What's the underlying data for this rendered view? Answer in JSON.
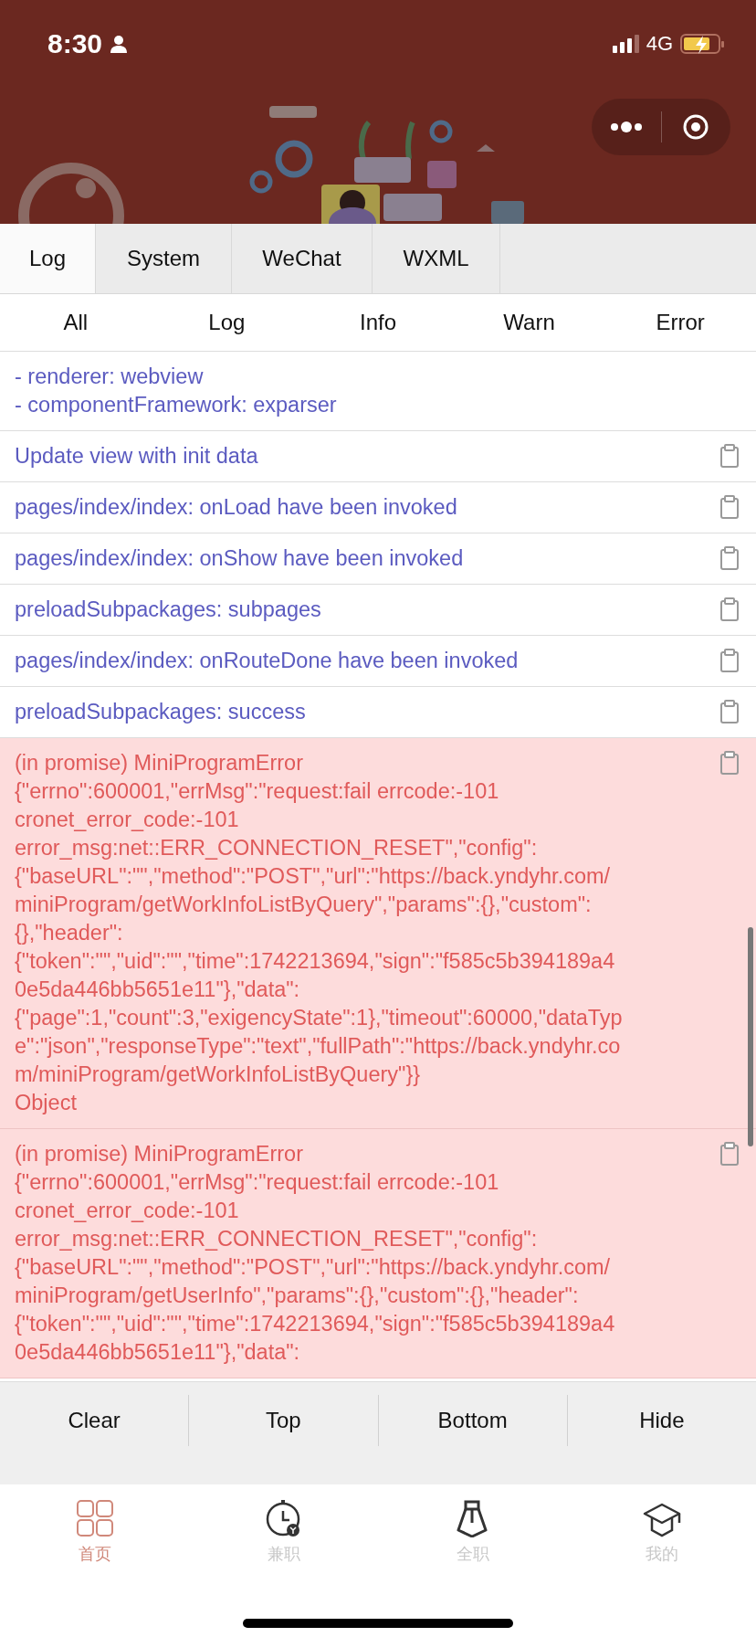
{
  "status_bar": {
    "time": "8:30",
    "network": "4G"
  },
  "console": {
    "tabs": [
      {
        "label": "Log",
        "selected": true
      },
      {
        "label": "System",
        "selected": false
      },
      {
        "label": "WeChat",
        "selected": false
      },
      {
        "label": "WXML",
        "selected": false
      }
    ],
    "filters": [
      "All",
      "Log",
      "Info",
      "Warn",
      "Error"
    ],
    "entries": [
      {
        "kind": "log",
        "copy_button": false,
        "lines": [
          "- renderer: webview",
          "- componentFramework: exparser"
        ]
      },
      {
        "kind": "log",
        "copy_button": true,
        "lines": [
          "Update view with init data"
        ]
      },
      {
        "kind": "log",
        "copy_button": true,
        "lines": [
          "pages/index/index: onLoad have been invoked"
        ]
      },
      {
        "kind": "log",
        "copy_button": true,
        "lines": [
          "pages/index/index: onShow have been invoked"
        ]
      },
      {
        "kind": "log",
        "copy_button": true,
        "lines": [
          "preloadSubpackages: subpages"
        ]
      },
      {
        "kind": "log",
        "copy_button": true,
        "lines": [
          "pages/index/index: onRouteDone have been invoked"
        ]
      },
      {
        "kind": "log",
        "copy_button": true,
        "lines": [
          "preloadSubpackages: success"
        ]
      },
      {
        "kind": "error",
        "copy_button": true,
        "lines": [
          "(in promise) MiniProgramError",
          "{\"errno\":600001,\"errMsg\":\"request:fail errcode:-101",
          "cronet_error_code:-101",
          "error_msg:net::ERR_CONNECTION_RESET\",\"config\":",
          "{\"baseURL\":\"\",\"method\":\"POST\",\"url\":\"https://back.yndyhr.com/",
          "miniProgram/getWorkInfoListByQuery\",\"params\":{},\"custom\":",
          "{},\"header\":",
          "{\"token\":\"\",\"uid\":\"\",\"time\":1742213694,\"sign\":\"f585c5b394189a4",
          "0e5da446bb5651e11\"},\"data\":",
          "{\"page\":1,\"count\":3,\"exigencyState\":1},\"timeout\":60000,\"dataTyp",
          "e\":\"json\",\"responseType\":\"text\",\"fullPath\":\"https://back.yndyhr.co",
          "m/miniProgram/getWorkInfoListByQuery\"}}",
          "Object"
        ]
      },
      {
        "kind": "error",
        "copy_button": true,
        "lines": [
          "(in promise) MiniProgramError",
          "{\"errno\":600001,\"errMsg\":\"request:fail errcode:-101",
          "cronet_error_code:-101",
          "error_msg:net::ERR_CONNECTION_RESET\",\"config\":",
          "{\"baseURL\":\"\",\"method\":\"POST\",\"url\":\"https://back.yndyhr.com/",
          "miniProgram/getUserInfo\",\"params\":{},\"custom\":{},\"header\":",
          "{\"token\":\"\",\"uid\":\"\",\"time\":1742213694,\"sign\":\"f585c5b394189a4",
          "0e5da446bb5651e11\"},\"data\":"
        ]
      }
    ],
    "buttons": [
      "Clear",
      "Top",
      "Bottom",
      "Hide"
    ]
  },
  "tab_bar": [
    {
      "kind": "grid",
      "label": "首页",
      "selected": true
    },
    {
      "kind": "clock",
      "label": "兼职",
      "selected": false
    },
    {
      "kind": "tie",
      "label": "全职",
      "selected": false
    },
    {
      "kind": "cap",
      "label": "我的",
      "selected": false
    }
  ]
}
